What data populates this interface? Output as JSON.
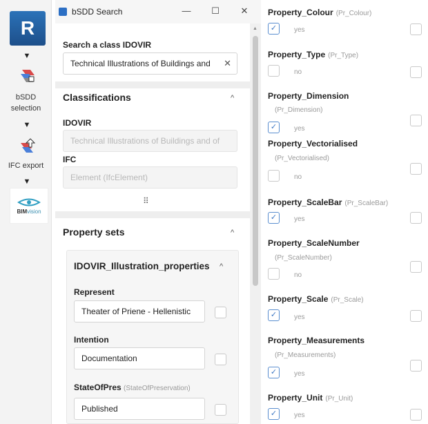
{
  "toolbar": {
    "revit_letter": "R",
    "arrow": "▼",
    "bsdd_selection_label": "bSDD selection",
    "ifc_export_label": "IFC export",
    "bim_brand": "BIM",
    "bim_suffix": "vision"
  },
  "window": {
    "title": "bSDD Search",
    "minimize": "—",
    "maximize": "☐",
    "close": "✕"
  },
  "search": {
    "label": "Search a class IDOVIR",
    "value": "Technical Illustrations of Buildings and",
    "clear": "✕"
  },
  "classifications": {
    "title": "Classifications",
    "chevron": "^",
    "idovir_label": "IDOVIR",
    "idovir_value": "Technical Illustrations of Buildings and of",
    "ifc_label": "IFC",
    "ifc_value": "Element (IfcElement)",
    "more": "⠿"
  },
  "property_sets": {
    "title": "Property sets",
    "chevron": "^",
    "set_name": "IDOVIR_Illustration_properties",
    "set_chevron": "^",
    "fields": [
      {
        "label": "Represent",
        "code": "",
        "value": "Theater of Priene - Hellenistic"
      },
      {
        "label": "Intention",
        "code": "",
        "value": "Documentation"
      },
      {
        "label": "StateOfPres",
        "code": "(StateOfPreservation)",
        "value": "Published"
      }
    ]
  },
  "properties": [
    {
      "name": "Property_Colour",
      "code": "(Pr_Colour)",
      "value": "yes",
      "checked": true
    },
    {
      "name": "Property_Type",
      "code": "(Pr_Type)",
      "value": "no",
      "checked": false
    },
    {
      "name": "Property_Dimension",
      "code": "(Pr_Dimension)",
      "value": "yes",
      "checked": true
    },
    {
      "name": "Property_Vectorialised",
      "code": "(Pr_Vectorialised)",
      "value": "no",
      "checked": false
    },
    {
      "name": "Property_ScaleBar",
      "code": "(Pr_ScaleBar)",
      "value": "yes",
      "checked": true
    },
    {
      "name": "Property_ScaleNumber",
      "code": "(Pr_ScaleNumber)",
      "value": "no",
      "checked": false
    },
    {
      "name": "Property_Scale",
      "code": "(Pr_Scale)",
      "value": "yes",
      "checked": true
    },
    {
      "name": "Property_Measurements",
      "code": "(Pr_Measurements)",
      "value": "yes",
      "checked": true
    },
    {
      "name": "Property_Unit",
      "code": "(Pr_Unit)",
      "value": "yes",
      "checked": true
    }
  ],
  "check_glyph": "✓",
  "colors": {
    "accent": "#2b72b8",
    "checkbox": "#5a8ecf"
  }
}
